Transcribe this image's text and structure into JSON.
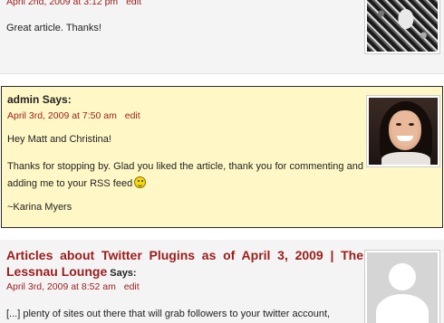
{
  "comments": [
    {
      "date": "April 2nd, 2009 at 3:12 pm",
      "edit": "edit",
      "body": "Great article. Thanks!",
      "avatar": "user-photo"
    },
    {
      "author": "admin",
      "says": "Says:",
      "date": "April 3rd, 2009 at 7:50 am",
      "edit": "edit",
      "p1": "Hey Matt and Christina!",
      "p2": "Thanks for stopping by. Glad you liked the article, thank you for commenting and adding me to your RSS feed",
      "p3": "~Karina Myers",
      "emoticon": "smiley-icon",
      "highlight_color": "#fff8c6",
      "avatar": "user-photo"
    },
    {
      "author": "Articles about Twitter Plugins as of April 3, 2009 | The Lessnau Lounge",
      "says": "Says:",
      "date": "April 3rd, 2009 at 8:52 am",
      "edit": "edit",
      "body": "[...] plenty of sites out there that will grab followers to your twitter account,",
      "avatar": "default-avatar"
    }
  ],
  "link_color": "#9b1c1c"
}
